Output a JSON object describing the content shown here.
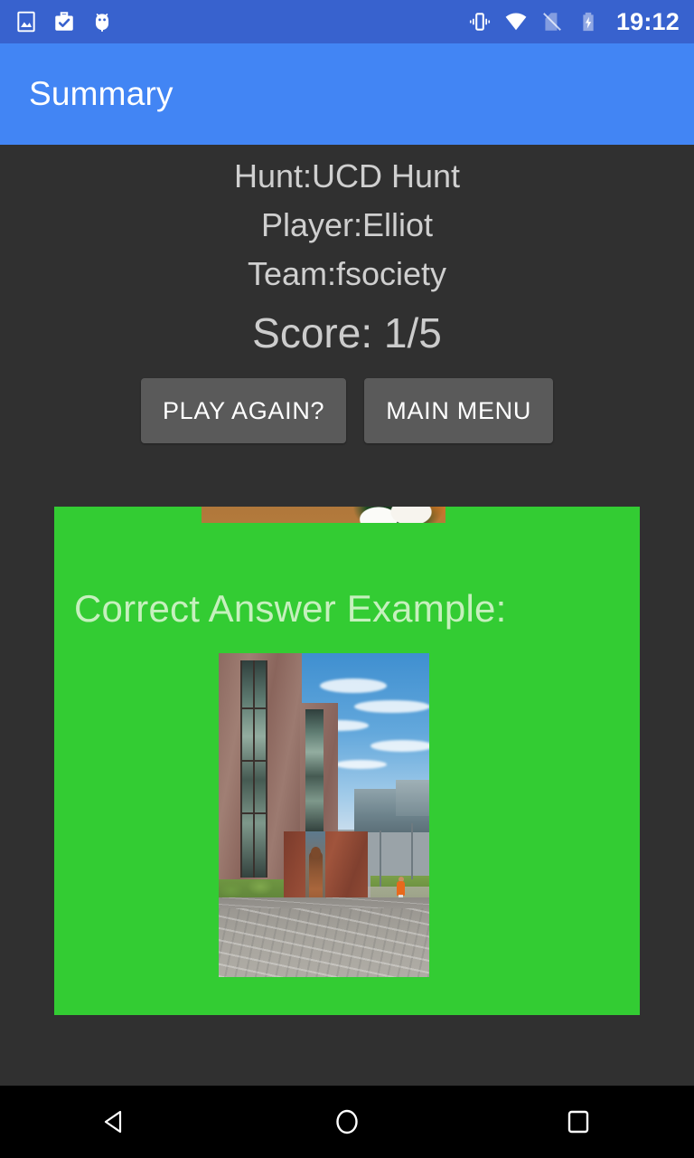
{
  "status_bar": {
    "background_color": "#3862CE",
    "time": "19:12",
    "left_icons": [
      {
        "name": "screenshot-image-icon",
        "label": "screenshot"
      },
      {
        "name": "work-profile-check-icon",
        "label": "work profile"
      },
      {
        "name": "android-debug-icon",
        "label": "usb debugging"
      }
    ],
    "right_icons": [
      {
        "name": "vibrate-icon",
        "label": "vibrate mode"
      },
      {
        "name": "wifi-icon",
        "label": "wifi full"
      },
      {
        "name": "no-sim-icon",
        "label": "no sim card"
      },
      {
        "name": "battery-charging-icon",
        "label": "battery charging"
      }
    ]
  },
  "app_bar": {
    "title": "Summary",
    "background_color": "#4285F4",
    "text_color": "#FFFFFF"
  },
  "summary": {
    "hunt_line": "Hunt:UCD Hunt",
    "player_line": "Player:Elliot",
    "team_line": "Team:fsociety",
    "score_line": "Score: 1/5",
    "text_color": "#CFCFCF",
    "background_color": "#303030"
  },
  "buttons": {
    "play_again": "PLAY AGAIN?",
    "main_menu": "MAIN MENU",
    "background_color": "#5A5A5A",
    "text_color": "#FFFFFF"
  },
  "answer_card": {
    "background_color": "#33CC33",
    "title": "Correct Answer Example:",
    "title_color": "#C6F0BE",
    "previous_photo": {
      "name": "previous-answer-photo-cropped",
      "description": "wooden table top with white cup and dark green plant"
    },
    "answer_photo": {
      "name": "correct-answer-photo",
      "description": "UCD campus plaza with brick building, bronze statue on rust wall, paved walkway, person in orange shirt"
    }
  },
  "nav_bar": {
    "background_color": "#000000",
    "buttons": [
      {
        "name": "nav-back-button",
        "label": "Back"
      },
      {
        "name": "nav-home-button",
        "label": "Home"
      },
      {
        "name": "nav-recents-button",
        "label": "Recents"
      }
    ]
  }
}
